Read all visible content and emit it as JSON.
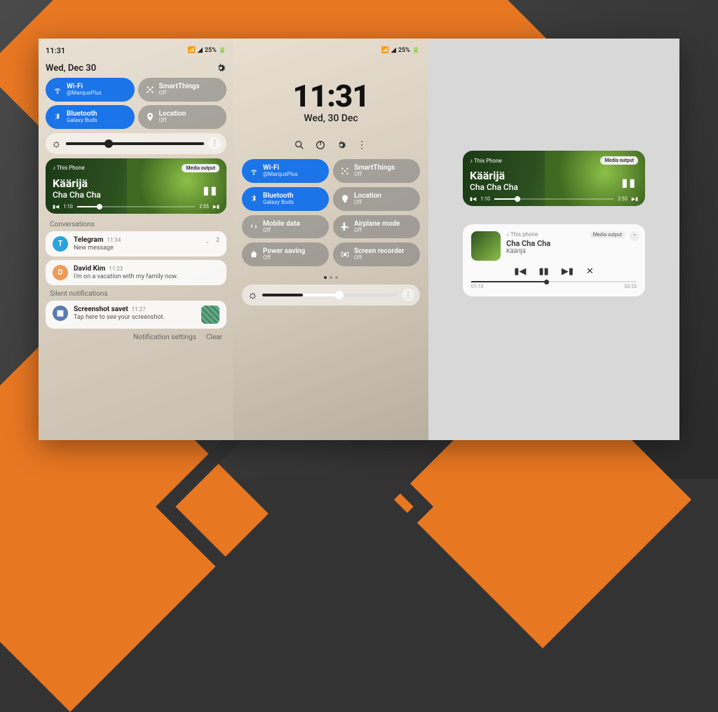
{
  "status": {
    "time": "11:31",
    "battery": "25%",
    "signal": "📶",
    "wifi": "📡"
  },
  "panel1": {
    "date": "Wed, Dec 30",
    "toggles": [
      {
        "title": "Wi-Fi",
        "sub": "@MarqusPlus",
        "on": true
      },
      {
        "title": "SmartThings",
        "sub": "Off",
        "on": false
      },
      {
        "title": "Bluetooth",
        "sub": "Galaxy Buds",
        "on": true
      },
      {
        "title": "Location",
        "sub": "Off",
        "on": false
      }
    ],
    "media": {
      "source": "This Phone",
      "output": "Media output",
      "artist": "Käärijä",
      "track": "Cha Cha Cha",
      "elapsed": "1:10",
      "total": "2:55"
    },
    "sections": {
      "conversations": "Conversations",
      "silent": "Silent notifications"
    },
    "notifs": [
      {
        "app": "Telegram",
        "time": "11:34",
        "msg": "New message",
        "badge": "2",
        "color": "#2aa3df",
        "letter": "T"
      },
      {
        "app": "David Kim",
        "time": "11:23",
        "msg": "I'm on a vacation with my family now.",
        "badge": "",
        "color": "#f09a55",
        "letter": "D"
      }
    ],
    "silent_notif": {
      "app": "Screenshot savet",
      "time": "11:27",
      "msg": "Tap here to see your screenshot."
    },
    "footer": {
      "settings": "Notification settings",
      "clear": "Clear"
    }
  },
  "panel2": {
    "time": "11:31",
    "date": "Wed, 30 Dec",
    "toggles": [
      {
        "title": "Wi-Fi",
        "sub": "@MarqusPlus",
        "on": true
      },
      {
        "title": "SmartThings",
        "sub": "Off",
        "on": false
      },
      {
        "title": "Bluetooth",
        "sub": "Galaxy Buds",
        "on": true
      },
      {
        "title": "Location",
        "sub": "Off",
        "on": false
      },
      {
        "title": "Mobile data",
        "sub": "Off",
        "on": false
      },
      {
        "title": "Airplane mode",
        "sub": "Off",
        "on": false
      },
      {
        "title": "Power saving",
        "sub": "Off",
        "on": false
      },
      {
        "title": "Screen recorder",
        "sub": "Off",
        "on": false
      }
    ]
  },
  "panel3": {
    "media1": {
      "source": "This Phone",
      "output": "Media output",
      "artist": "Käärijä",
      "track": "Cha Cha Cha",
      "elapsed": "1:10",
      "total": "2:55"
    },
    "media2": {
      "source": "This phone",
      "output": "Media output",
      "track": "Cha Cha Cha",
      "artist": "Käärijä",
      "elapsed": "01:10",
      "total": "02:55"
    }
  }
}
